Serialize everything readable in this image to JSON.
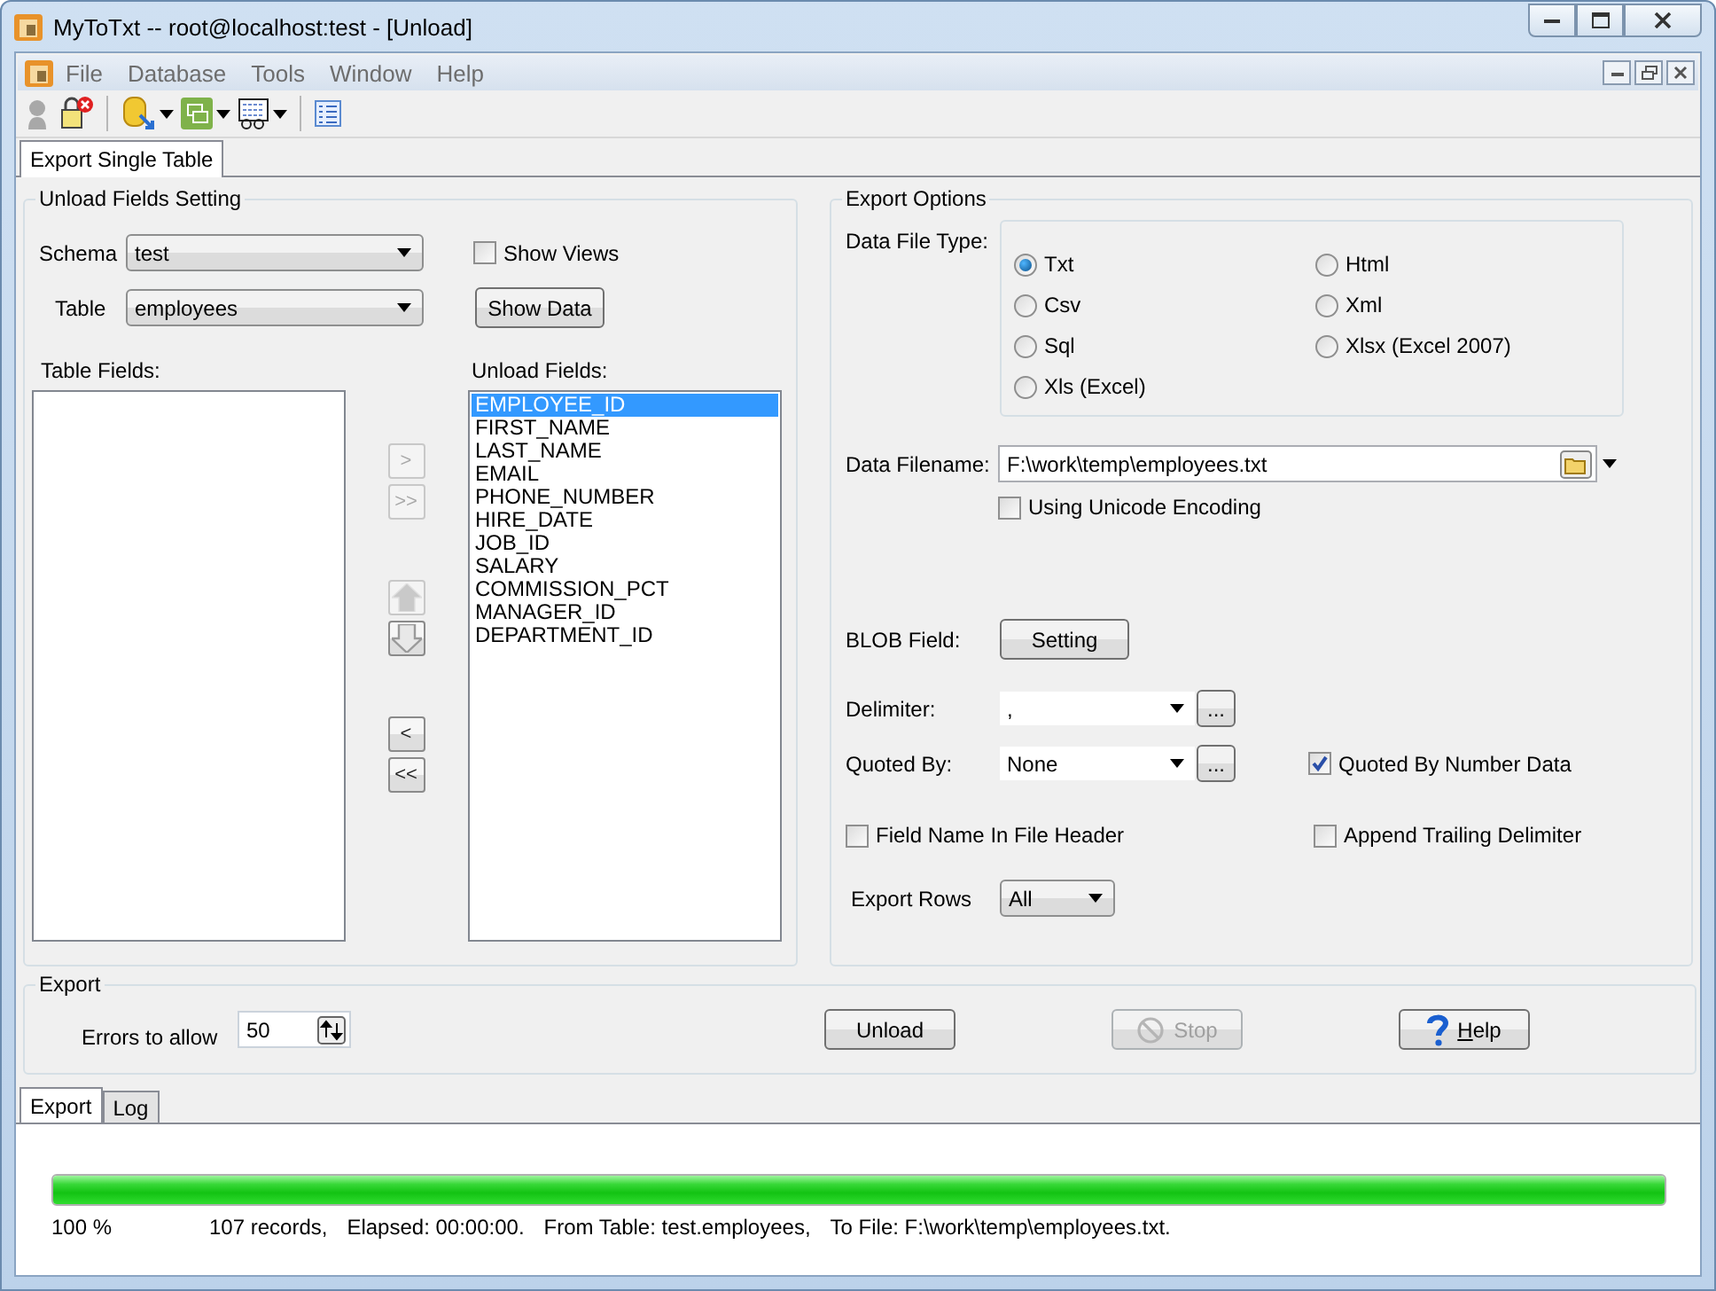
{
  "window": {
    "title": "MyToTxt -- root@localhost:test - [Unload]"
  },
  "menu": [
    "File",
    "Database",
    "Tools",
    "Window",
    "Help"
  ],
  "tabs": [
    {
      "label": "Export Single Table",
      "selected": true
    }
  ],
  "unload_fields_setting": {
    "title": "Unload Fields Setting",
    "schema": {
      "label": "Schema",
      "value": "test"
    },
    "table": {
      "label": "Table",
      "value": "employees"
    },
    "show_views": {
      "label": "Show Views",
      "checked": false
    },
    "show_data": "Show Data",
    "table_fields": {
      "label": "Table Fields:"
    },
    "unload_fields": {
      "label": "Unload Fields:",
      "items": [
        {
          "label": "EMPLOYEE_ID",
          "selected": true
        },
        {
          "label": "FIRST_NAME",
          "selected": false
        },
        {
          "label": "LAST_NAME",
          "selected": false
        },
        {
          "label": "EMAIL",
          "selected": false
        },
        {
          "label": "PHONE_NUMBER",
          "selected": false
        },
        {
          "label": "HIRE_DATE",
          "selected": false
        },
        {
          "label": "JOB_ID",
          "selected": false
        },
        {
          "label": "SALARY",
          "selected": false
        },
        {
          "label": "COMMISSION_PCT",
          "selected": false
        },
        {
          "label": "MANAGER_ID",
          "selected": false
        },
        {
          "label": "DEPARTMENT_ID",
          "selected": false
        }
      ]
    },
    "move_button_groups": [
      [
        {
          "kind": "text",
          "label": ">",
          "disabled": true
        },
        {
          "kind": "text",
          "label": ">>",
          "disabled": true
        }
      ],
      [
        {
          "kind": "up",
          "disabled": true
        },
        {
          "kind": "down",
          "disabled": false
        }
      ],
      [
        {
          "kind": "text",
          "label": "<",
          "disabled": false
        },
        {
          "kind": "text",
          "label": "<<",
          "disabled": false
        }
      ]
    ]
  },
  "export_options": {
    "title": "Export Options",
    "data_file_type": {
      "label": "Data File Type:",
      "options": [
        {
          "label": "Txt",
          "selected": true
        },
        {
          "label": "Html",
          "selected": false
        },
        {
          "label": "Csv",
          "selected": false
        },
        {
          "label": "Xml",
          "selected": false
        },
        {
          "label": "Sql",
          "selected": false
        },
        {
          "label": "Xlsx (Excel 2007)",
          "selected": false
        },
        {
          "label": "Xls (Excel)",
          "selected": false
        }
      ]
    },
    "data_filename": {
      "label": "Data Filename:",
      "value": "F:\\work\\temp\\employees.txt"
    },
    "unicode": {
      "label": "Using Unicode Encoding",
      "checked": false
    },
    "blob_field": {
      "label": "BLOB Field:",
      "button": "Setting"
    },
    "delimiter": {
      "label": "Delimiter:",
      "value": ",",
      "button": "..."
    },
    "quoted_by": {
      "label": "Quoted By:",
      "value": "None",
      "button": "..."
    },
    "quoted_by_number": {
      "label": "Quoted By Number Data",
      "checked": true
    },
    "field_name_header": {
      "label": "Field Name In File Header",
      "checked": false
    },
    "append_trailing": {
      "label": "Append Trailing Delimiter",
      "checked": false
    },
    "export_rows": {
      "label": "Export Rows",
      "value": "All"
    }
  },
  "export": {
    "title": "Export",
    "errors": {
      "label": "Errors to allow",
      "value": "50"
    },
    "buttons": [
      {
        "kind": "unload",
        "label": "Unload",
        "disabled": false
      },
      {
        "kind": "stop",
        "label": "Stop",
        "disabled": true
      },
      {
        "kind": "help",
        "label": "Help",
        "disabled": false
      }
    ]
  },
  "bottom_tabs": [
    {
      "label": "Export",
      "selected": true
    },
    {
      "label": "Log",
      "selected": false
    }
  ],
  "progress": {
    "level": 1,
    "percent": "100 %",
    "status": [
      "107 records,",
      "Elapsed: 00:00:00.",
      "From Table: test.employees,",
      "To File: F:\\work\\temp\\employees.txt."
    ]
  }
}
